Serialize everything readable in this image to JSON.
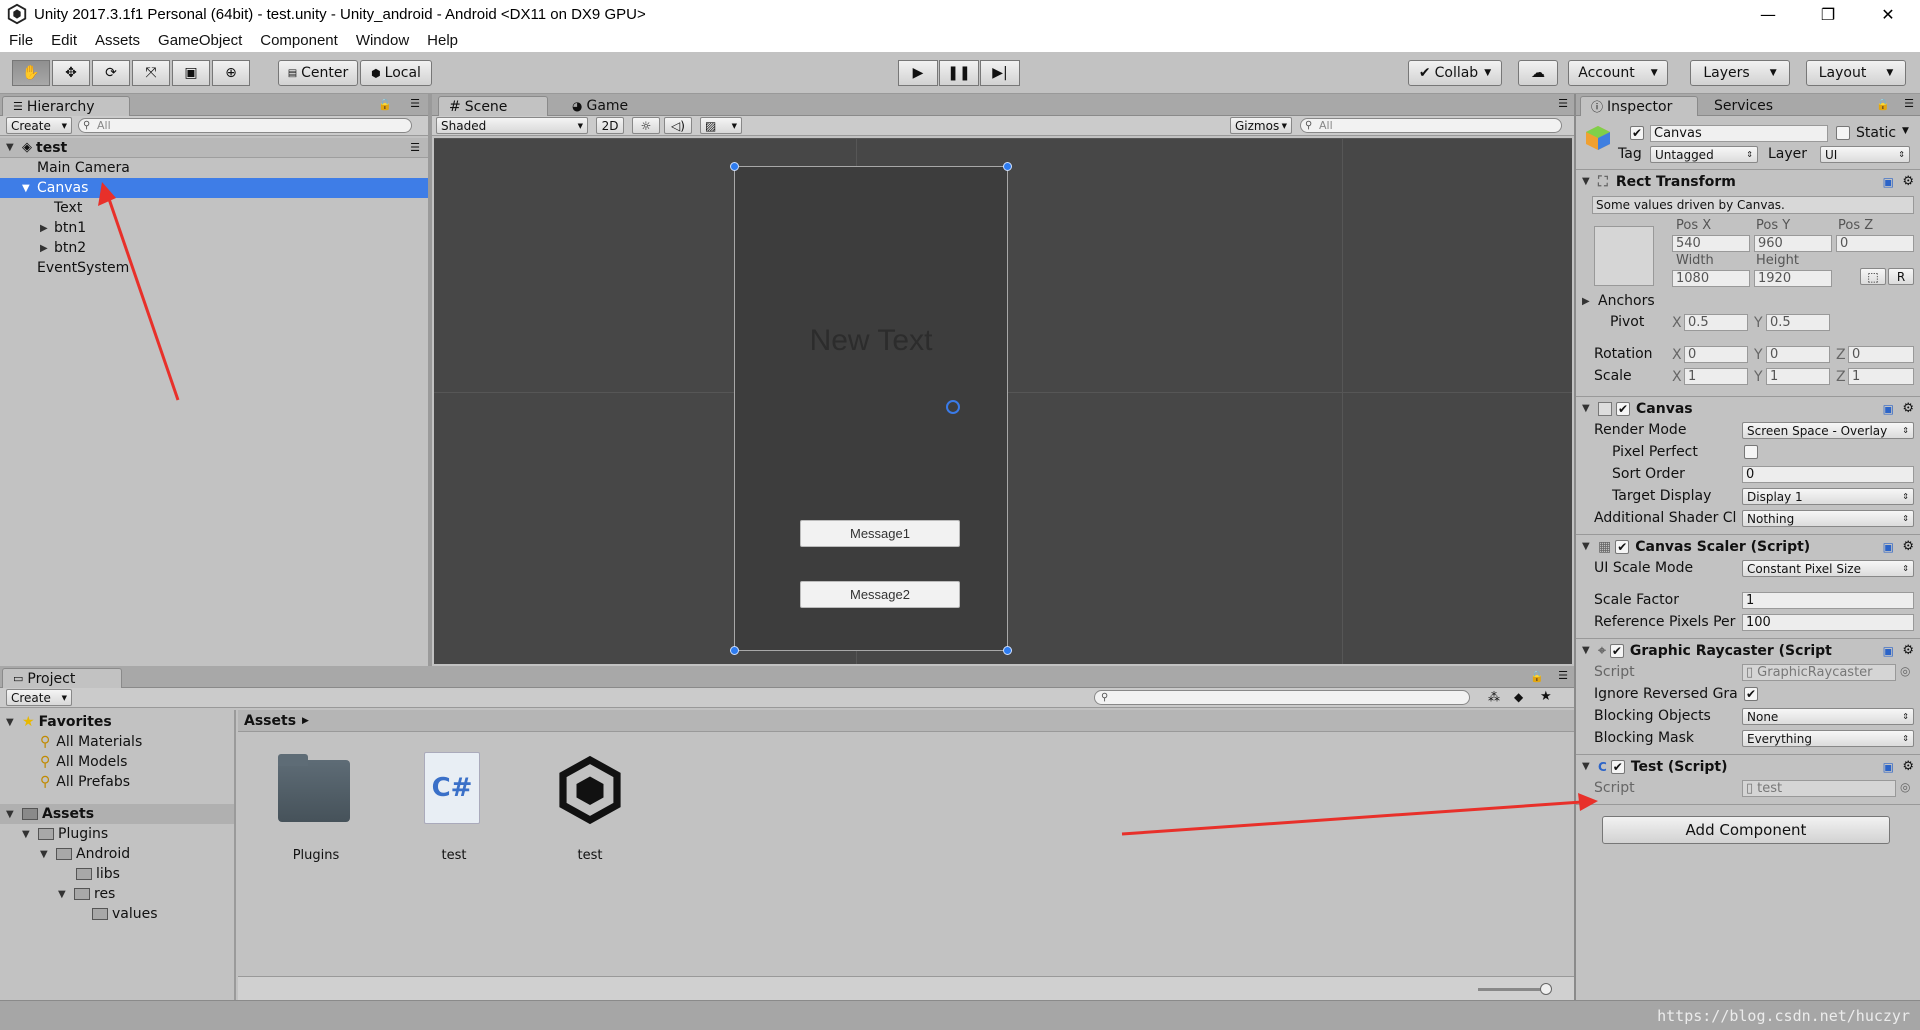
{
  "window": {
    "title": "Unity 2017.3.1f1 Personal (64bit) - test.unity - Unity_android - Android <DX11 on DX9 GPU>",
    "minimize": "—",
    "maximize": "❐",
    "close": "✕"
  },
  "menu": [
    "File",
    "Edit",
    "Assets",
    "GameObject",
    "Component",
    "Window",
    "Help"
  ],
  "toolbar": {
    "center": "Center",
    "local": "Local",
    "collab": "Collab",
    "account": "Account",
    "layers": "Layers",
    "layout": "Layout"
  },
  "hierarchy": {
    "tab": "Hierarchy",
    "create": "Create",
    "search_placeholder": "All",
    "scene": "test",
    "items": [
      "Main Camera",
      "Canvas",
      "Text",
      "btn1",
      "btn2",
      "EventSystem"
    ]
  },
  "scene": {
    "tab_scene": "Scene",
    "tab_game": "Game",
    "shaded": "Shaded",
    "mode_2d": "2D",
    "gizmos": "Gizmos",
    "search_placeholder": "All",
    "new_text": "New Text",
    "button1": "Message1",
    "button2": "Message2"
  },
  "inspector": {
    "tab": "Inspector",
    "tab_services": "Services",
    "object_name": "Canvas",
    "static": "Static",
    "tag_label": "Tag",
    "tag_value": "Untagged",
    "layer_label": "Layer",
    "layer_value": "UI",
    "rect_transform": "Rect Transform",
    "driven_note": "Some values driven by Canvas.",
    "pos_x_label": "Pos X",
    "pos_y_label": "Pos Y",
    "pos_z_label": "Pos Z",
    "pos_x": "540",
    "pos_y": "960",
    "pos_z": "0",
    "width_label": "Width",
    "height_label": "Height",
    "width": "1080",
    "height": "1920",
    "r_button": "R",
    "anchors": "Anchors",
    "pivot": "Pivot",
    "pivot_x": "0.5",
    "pivot_y": "0.5",
    "rotation": "Rotation",
    "rot_x": "0",
    "rot_y": "0",
    "rot_z": "0",
    "scale": "Scale",
    "scale_x": "1",
    "scale_y": "1",
    "scale_z": "1",
    "axis_x": "X",
    "axis_y": "Y",
    "axis_z": "Z",
    "canvas": "Canvas",
    "render_mode_label": "Render Mode",
    "render_mode": "Screen Space - Overlay",
    "pixel_perfect": "Pixel Perfect",
    "sort_order_label": "Sort Order",
    "sort_order": "0",
    "target_display_label": "Target Display",
    "target_display": "Display 1",
    "additional_shader_label": "Additional Shader Cl",
    "additional_shader": "Nothing",
    "canvas_scaler": "Canvas Scaler (Script)",
    "ui_scale_mode_label": "UI Scale Mode",
    "ui_scale_mode": "Constant Pixel Size",
    "scale_factor_label": "Scale Factor",
    "scale_factor": "1",
    "ref_pixels_label": "Reference Pixels Per",
    "ref_pixels": "100",
    "graphic_raycaster": "Graphic Raycaster (Script",
    "script_label": "Script",
    "gr_script": "GraphicRaycaster",
    "ignore_reversed_label": "Ignore Reversed Gra",
    "blocking_objects_label": "Blocking Objects",
    "blocking_objects": "None",
    "blocking_mask_label": "Blocking Mask",
    "blocking_mask": "Everything",
    "test_script": "Test (Script)",
    "test_script_value": "test",
    "add_component": "Add Component"
  },
  "project": {
    "tab": "Project",
    "create": "Create",
    "favorites": "Favorites",
    "fav_items": [
      "All Materials",
      "All Models",
      "All Prefabs"
    ],
    "assets": "Assets",
    "tree": [
      "Plugins",
      "Android",
      "libs",
      "res",
      "values"
    ],
    "breadcrumb": "Assets",
    "files": [
      "Plugins",
      "test",
      "test"
    ]
  },
  "watermark": "https://blog.csdn.net/huczyr",
  "colors": {
    "selection": "#3e7de7",
    "annotation_arrow": "#e8302a",
    "scene_bg": "#474747"
  }
}
